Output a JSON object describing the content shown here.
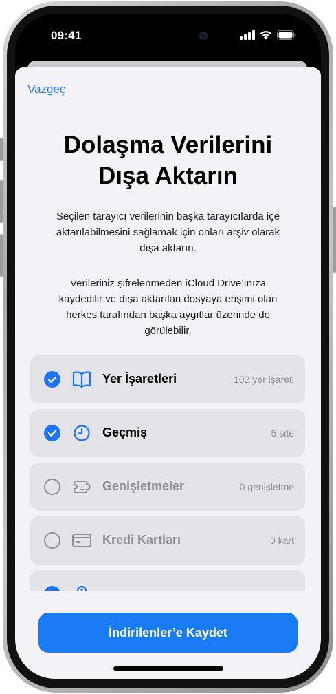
{
  "status_bar": {
    "time": "09:41"
  },
  "sheet": {
    "cancel_label": "Vazgeç",
    "title_line1": "Dolaşma Verilerini",
    "title_line2": "Dışa Aktarın",
    "description1": "Seçilen tarayıcı verilerinin başka tarayıcılarda içe aktarılabilmesini sağlamak için onları arşiv olarak dışa aktarın.",
    "description2": "Verileriniz şifrelenmeden iCloud Drive’ınıza kaydedilir ve dışa aktarılan dosyaya erişimi olan herkes tarafından başka aygıtlar üzerinde de görülebilir.",
    "items": [
      {
        "label": "Yer İşaretleri",
        "count": "102 yer işareti",
        "checked": true,
        "icon": "book-icon"
      },
      {
        "label": "Geçmiş",
        "count": "5 site",
        "checked": true,
        "icon": "clock-icon"
      },
      {
        "label": "Genişletmeler",
        "count": "0 genişletme",
        "checked": false,
        "icon": "puzzle-icon"
      },
      {
        "label": "Kredi Kartları",
        "count": "0 kart",
        "checked": false,
        "icon": "credit-card-icon"
      },
      {
        "checked": true,
        "icon": "key-icon"
      }
    ],
    "save_label": "İndirilenler’e Kaydet"
  },
  "colors": {
    "accent": "#1f74f2",
    "button": "#1a7cf5",
    "sheet_bg": "#f2f2f7",
    "row_bg": "#e3e3e8",
    "muted": "#8e8e93"
  }
}
